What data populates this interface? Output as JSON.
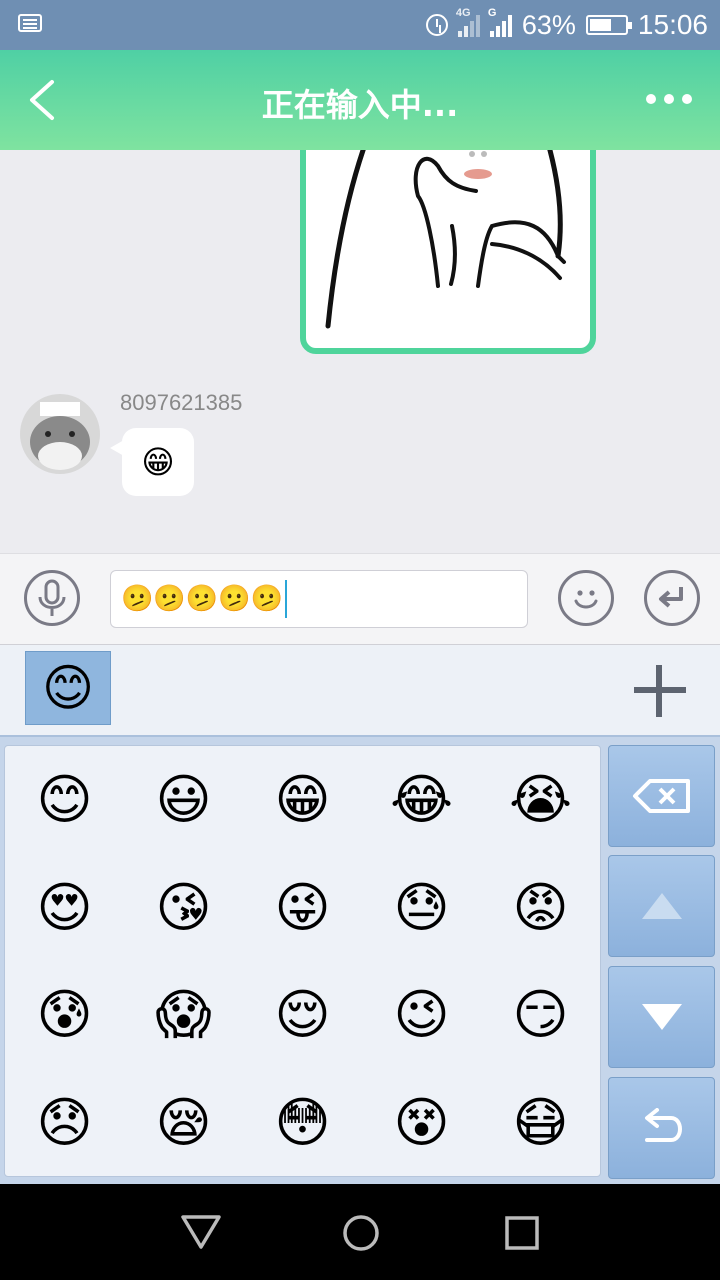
{
  "status_bar": {
    "network_1": "4G",
    "network_2": "G",
    "battery_percent": "63%",
    "battery_level": 0.63,
    "time": "15:06"
  },
  "header": {
    "title": "正在输入中..."
  },
  "chat": {
    "messages": [
      {
        "type": "sticker",
        "direction": "outgoing"
      },
      {
        "type": "emoji",
        "direction": "incoming",
        "sender": "8097621385",
        "content": "😁"
      }
    ]
  },
  "input": {
    "value": "🫤🫤🫤🫤🫤"
  },
  "emoji_panel": {
    "selected_tab": "😊",
    "emojis": [
      "😊",
      "😃",
      "😁",
      "😂",
      "😭",
      "😍",
      "😘",
      "😜",
      "😓",
      "😡",
      "😰",
      "😱",
      "😌",
      "😉",
      "😏",
      "😞",
      "😪",
      "😳",
      "😵",
      "😷"
    ]
  },
  "colors": {
    "header_start": "#4fd0a4",
    "header_end": "#7fe3a0",
    "status_bar": "#6f8fb3",
    "keyboard_bg": "#c5d5ea",
    "sticker_border": "#4fd49b"
  }
}
